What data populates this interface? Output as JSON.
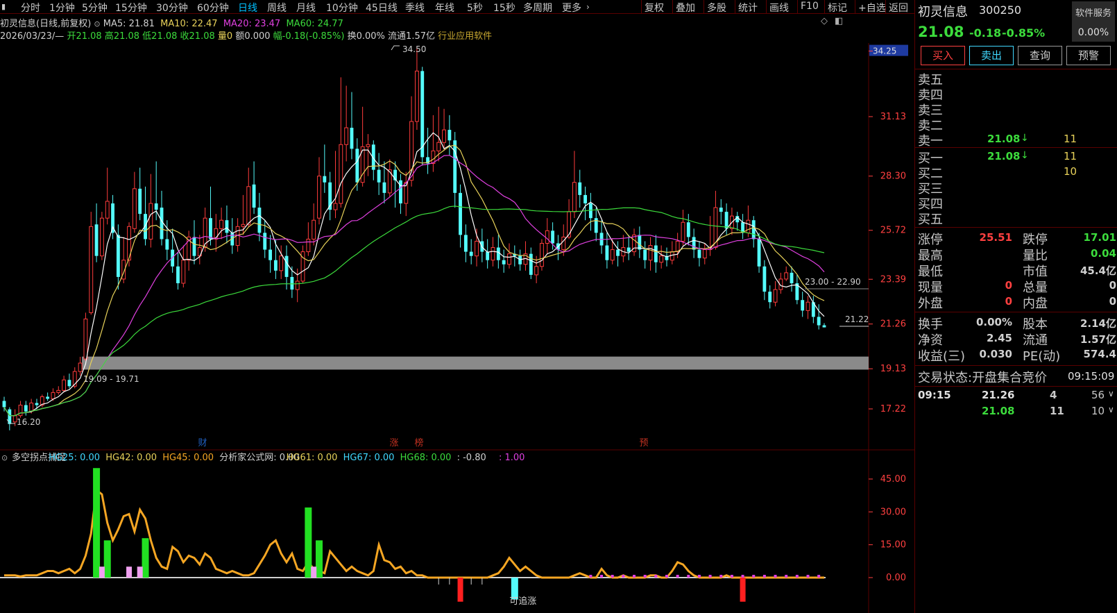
{
  "toolbar": {
    "periods": [
      "分时",
      "1分钟",
      "5分钟",
      "15分钟",
      "30分钟",
      "60分钟",
      "日线",
      "周线",
      "月线",
      "10分钟",
      "45日线",
      "季线",
      "年线",
      "5秒",
      "15秒",
      "多周期",
      "更多"
    ],
    "active_period": "日线",
    "right_buttons": [
      "复权",
      "叠加",
      "多股",
      "统计",
      "画线",
      "F10",
      "标记",
      "+自选",
      "返回"
    ]
  },
  "chart_header": {
    "title": "初灵信息(日线,前复权)",
    "ma5": "MA5: 21.81",
    "ma10": "MA10: 22.47",
    "ma20": "MA20: 23.47",
    "ma60": "MA60: 24.77",
    "date": "2026/03/23/—",
    "open": "开21.08",
    "high": "高21.08",
    "low": "低21.08",
    "close": "收21.08",
    "volume": "量0",
    "amount": "额0.000",
    "change": "幅-0.18(-0.85%)",
    "turnover": "换0.00%",
    "float": "流通1.57亿",
    "industry": "行业应用软件"
  },
  "price_axis": {
    "ticks": [
      "34.25",
      "31.13",
      "28.30",
      "25.72",
      "23.39",
      "21.26",
      "19.13",
      "17.22"
    ],
    "highlight": "34.25"
  },
  "annotations": {
    "high_label": "34.50",
    "low_label": "16.20",
    "last_label": "21.22",
    "range_upper": "23.00 - 22.90",
    "range_lower": "19.09 - 19.71",
    "marks": [
      "财",
      "涨",
      "榜",
      "预"
    ]
  },
  "indicator": {
    "name": "多空拐点捕捉",
    "hg25": "HG25: 0.00",
    "hg42": "HG42: 0.00",
    "hg45": "HG45: 0.00",
    "fxj": "分析家公式网: 0.00",
    "hg61": "HG61: 0.00",
    "hg67": "HG67: 0.00",
    "hg68": "HG68: 0.00",
    "v1": ": -0.80",
    "v2": ": 1.00",
    "ticks": [
      "45.00",
      "30.00",
      "15.00",
      "0.00"
    ],
    "signal": "可追涨"
  },
  "stock": {
    "name": "初灵信息",
    "code": "300250",
    "price": "21.08",
    "change": "-0.18",
    "change_pct": "-0.85%",
    "service_label": "软件服务",
    "service_value": "0.00%"
  },
  "trade_buttons": [
    "买入",
    "卖出",
    "查询",
    "预警"
  ],
  "orderbook": {
    "asks": [
      {
        "label": "卖五",
        "price": "",
        "vol": ""
      },
      {
        "label": "卖四",
        "price": "",
        "vol": ""
      },
      {
        "label": "卖三",
        "price": "",
        "vol": ""
      },
      {
        "label": "卖二",
        "price": "",
        "vol": ""
      },
      {
        "label": "卖一",
        "price": "21.08",
        "vol": "11"
      }
    ],
    "bids": [
      {
        "label": "买一",
        "price": "21.08",
        "vol": "11"
      },
      {
        "label": "买二",
        "price": "",
        "vol": "10"
      },
      {
        "label": "买三",
        "price": "",
        "vol": ""
      },
      {
        "label": "买四",
        "price": "",
        "vol": ""
      },
      {
        "label": "买五",
        "price": "",
        "vol": ""
      }
    ]
  },
  "stats": [
    {
      "l1": "涨停",
      "v1": "25.51",
      "l2": "跌停",
      "v2": "17.01"
    },
    {
      "l1": "最高",
      "v1": "",
      "l2": "量比",
      "v2": "0.04"
    },
    {
      "l1": "最低",
      "v1": "",
      "l2": "市值",
      "v2": "45.4亿"
    },
    {
      "l1": "现量",
      "v1": "0",
      "l2": "总量",
      "v2": "0"
    },
    {
      "l1": "外盘",
      "v1": "0",
      "l2": "内盘",
      "v2": "0"
    }
  ],
  "stats2": [
    {
      "l1": "换手",
      "v1": "0.00%",
      "l2": "股本",
      "v2": "2.14亿"
    },
    {
      "l1": "净资",
      "v1": "2.45",
      "l2": "流通",
      "v2": "1.57亿"
    },
    {
      "l1": "收益(三)",
      "v1": "0.030",
      "l2": "PE(动)",
      "v2": "574.4"
    }
  ],
  "trade_status": {
    "label": "交易状态:",
    "value": "开盘集合竞价",
    "time": "09:15:09"
  },
  "ticks": [
    {
      "time": "09:15",
      "price": "21.26",
      "vol": "4",
      "extra": "56"
    },
    {
      "time": "",
      "price": "21.08",
      "vol": "11",
      "extra": "10"
    }
  ],
  "colors": {
    "up": "#ff3c3c",
    "down": "#54fcfc",
    "ma5": "#ffffff",
    "ma10": "#e8d25a",
    "ma20": "#e040e0",
    "ma60": "#3cdc3c",
    "indicator_line": "#f5a623"
  }
}
